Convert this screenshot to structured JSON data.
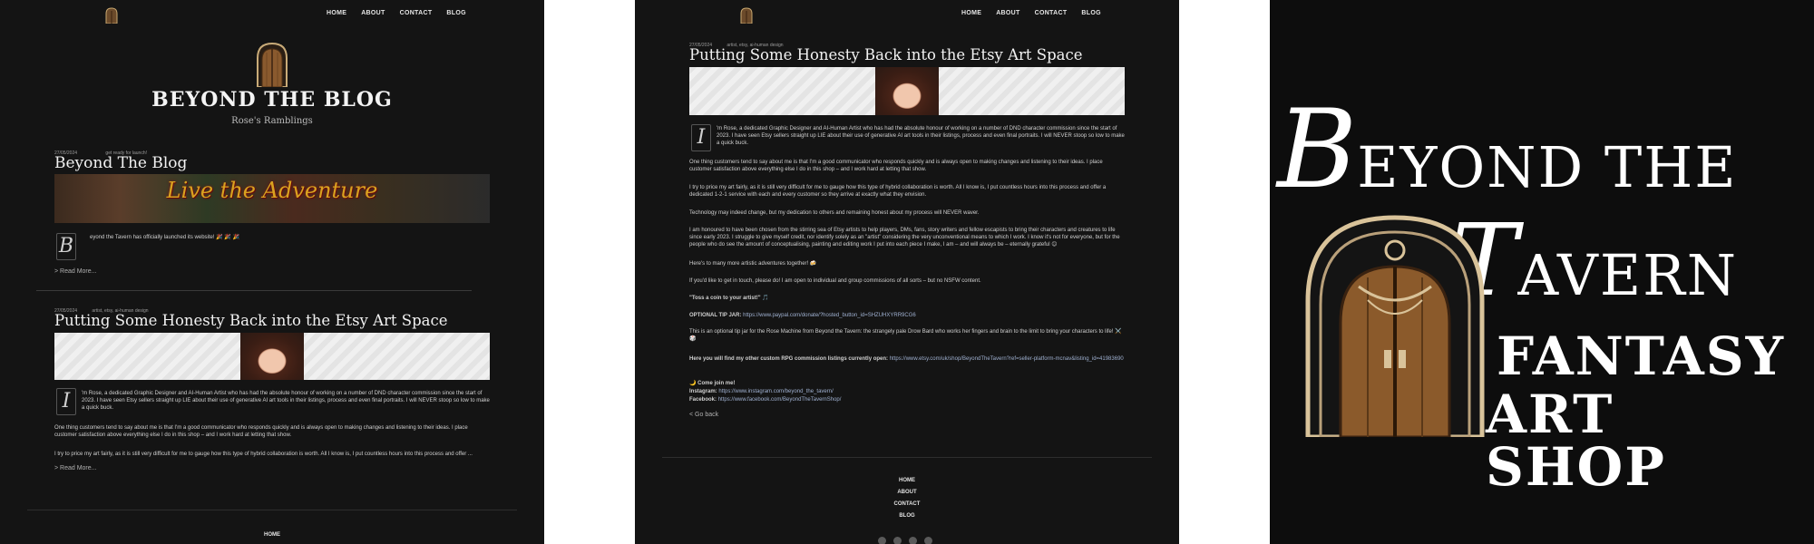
{
  "nav": {
    "items": [
      "HOME",
      "ABOUT",
      "CONTACT",
      "BLOG"
    ]
  },
  "panel1": {
    "hero_title": "BEYOND THE BLOG",
    "hero_subtitle": "Rose's Ramblings",
    "post1": {
      "date": "27/05/2024",
      "tags": "get ready for launch!",
      "title": "Beyond The Blog",
      "banner_text": "Live the Adventure",
      "dropcap": "B",
      "excerpt": "eyond the Tavern has officially launched its website! 🎉 🎉 🎉",
      "read_more": "> Read More..."
    },
    "post2": {
      "date": "27/05/2024",
      "tags": "artist, etsy, ai-human design",
      "title": "Putting Some Honesty Back into the Etsy Art Space",
      "dropcap": "I",
      "p1": "'m Rose, a dedicated Graphic Designer and AI-Human Artist who has had the absolute honour of working on a number of DND character commission since the start of 2023. I have seen Etsy sellers straight up LIE about their use of generative AI art tools in their listings, process and even final portraits. I will NEVER stoop so low to make a quick buck.",
      "p2": "One thing customers tend to say about me is that I'm a good communicator who responds quickly and is always open to making changes and listening to their ideas. I place customer satisfaction above everything else I do in this shop – and I work hard at letting that show.",
      "p3": "I try to price my art fairly, as it is still very difficult for me to gauge how this type of hybrid collaboration is worth. All I know is, I put countless hours into this process and offer ...",
      "read_more": "> Read More..."
    },
    "footer_first": "HOME"
  },
  "panel2": {
    "date": "27/05/2024",
    "tags": "artist, etsy, ai-human design",
    "title": "Putting Some Honesty Back into the Etsy Art Space",
    "dropcap": "I",
    "paragraphs": [
      "'m Rose, a dedicated Graphic Designer and AI-Human Artist who has had the absolute honour of working on a number of DND character commission since the start of 2023. I have seen Etsy sellers straight up LIE about their use of generative AI art tools in their listings, process and even final portraits. I will NEVER stoop so low to make a quick buck.",
      "One thing customers tend to say about me is that I'm a good communicator who responds quickly and is always open to making changes and listening to their ideas. I place customer satisfaction above everything else I do in this shop – and I work hard at letting that show.",
      "I try to price my art fairly, as it is still very difficult for me to gauge how this type of hybrid collaboration is worth. All I know is, I put countless hours into this process and offer a dedicated 1-2-1 service with each and every customer so they arrive at exactly what they envision.",
      "Technology may indeed change, but my dedication to others and remaining honest about my process will NEVER waver.",
      "I am honoured to have been chosen from the stirring sea of Etsy artists to help players, DMs, fans, story writers and fellow escapists to bring their characters and creatures to life since early 2023. I struggle to give myself credit, nor identify solely as an \"artist\" considering the very unconventional means to which I work. I know it's not for everyone, but for the people who do see the amount of conceptualising, painting and editing work I put into each piece I make, I am – and will always be – eternally grateful 😊",
      "Here's to many more artistic adventures together! 🍻",
      "If you'd like to get in touch, please do! I am open to individual and group commissions of all sorts – but no NSFW content.",
      "\"Toss a coin to your artist!\" 🎵"
    ],
    "tip_label": "OPTIONAL TIP JAR:",
    "tip_url": "https://www.paypal.com/donate/?hosted_button_id=SHZUHXYRR9CG6",
    "tip_note": "This is an optional tip jar for the Rose Machine from Beyond the Tavern: the strangely pale Drow Bard who works her fingers and brain to the limit to bring your characters to life! ⚔️ 🎲",
    "listings_label": "Here you will find my other custom RPG commission listings currently open:",
    "listings_url": "https://www.etsy.com/uk/shop/BeyondTheTavern?ref=seller-platform-mcnav&listing_id=41983690",
    "join_label": "🌙 Come join me!",
    "instagram_label": "Instagram:",
    "instagram_url": "https://www.instagram.com/beyond_the_tavern/",
    "facebook_label": "Facebook:",
    "facebook_url": "https://www.facebook.com/BeyondTheTavernShop/",
    "go_back": "< Go back",
    "footer_links": [
      "HOME",
      "ABOUT",
      "CONTACT",
      "BLOG"
    ]
  },
  "panel3": {
    "line1_b": "B",
    "line1_rest": "EYOND THE",
    "line2_t": "T",
    "line2_rest": "AVERN",
    "line3": "FANTASY",
    "line4": "ART SHOP"
  }
}
